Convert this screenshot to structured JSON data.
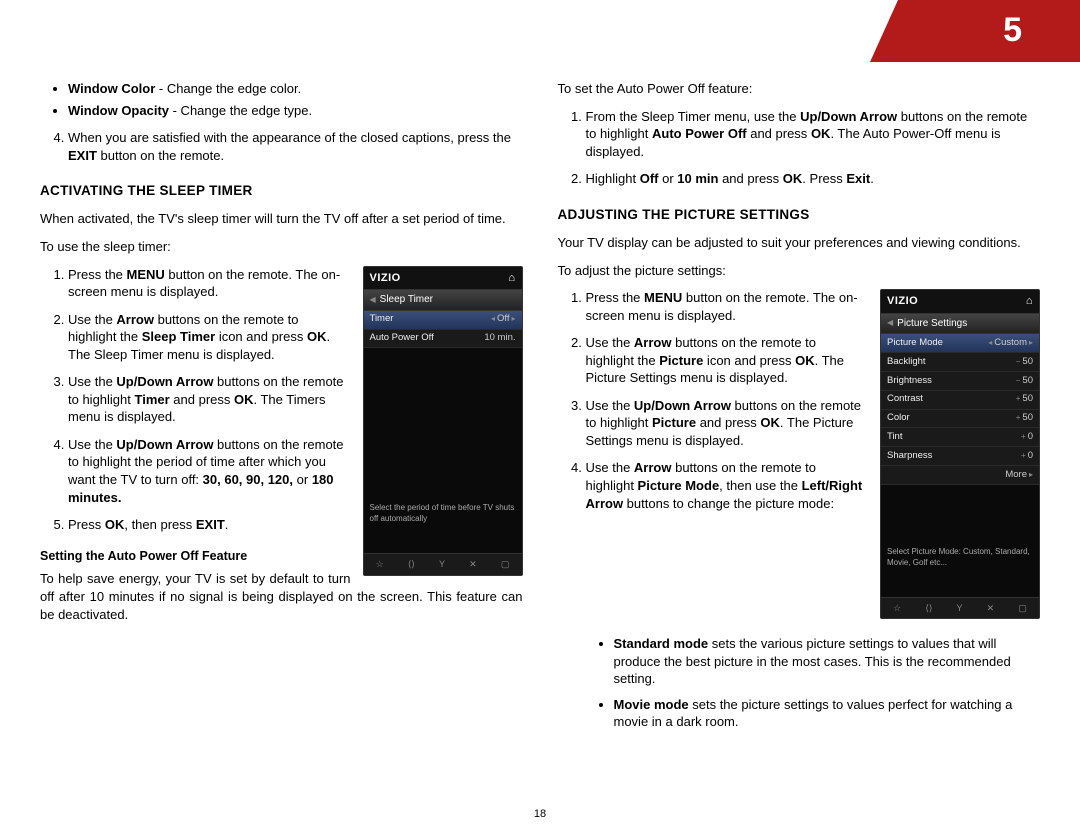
{
  "chapter": "5",
  "pageNumber": "18",
  "col1": {
    "bullets": [
      {
        "label": "Window Color",
        "desc": " - Change the edge color."
      },
      {
        "label": "Window Opacity",
        "desc": " - Change the edge type."
      }
    ],
    "step4_pre": "When you are satisfied with the appearance of the closed captions, press the ",
    "step4_bold": "EXIT",
    "step4_post": " button on the remote.",
    "h_sleeptimer": "Activating the Sleep Timer",
    "sleep_intro": "When activated, the TV's sleep timer will turn the TV off after a set period of time.",
    "sleep_lead": "To use the sleep timer:",
    "sleep_steps": {
      "s1a": "Press the ",
      "s1b": "MENU",
      "s1c": " button on the remote. The on-screen menu is displayed.",
      "s2a": "Use the ",
      "s2b": "Arrow",
      "s2c": " buttons on the remote to highlight the ",
      "s2d": "Sleep Timer",
      "s2e": " icon and press ",
      "s2f": "OK",
      "s2g": ". The Sleep Timer menu is displayed.",
      "s3a": "Use the ",
      "s3b": "Up/Down Arrow",
      "s3c": " buttons on the remote to highlight ",
      "s3d": "Timer",
      "s3e": " and press ",
      "s3f": "OK",
      "s3g": ". The Timers menu is displayed.",
      "s4a": "Use the ",
      "s4b": "Up/Down Arrow",
      "s4c": " buttons on the remote to highlight the period of time after which you want the TV to turn off: ",
      "s4d": "30, 60, 90, 120,",
      "s4e": " or ",
      "s4f": "180 minutes.",
      "s5a": "Press ",
      "s5b": "OK",
      "s5c": ", then press ",
      "s5d": "EXIT",
      "s5e": "."
    },
    "h_autopower": "Setting the Auto Power Off Feature",
    "autopower_para": "To help save energy, your TV is set by default to turn off after 10 minutes if no signal is being displayed on the screen. This feature can be deactivated."
  },
  "col2": {
    "ap_lead": "To set the Auto Power Off feature:",
    "ap_steps": {
      "s1a": "From the Sleep Timer menu, use the ",
      "s1b": "Up/Down Arrow",
      "s1c": " buttons on the remote to highlight ",
      "s1d": "Auto Power Off",
      "s1e": " and press ",
      "s1f": "OK",
      "s1g": ". The Auto Power-Off menu is displayed.",
      "s2a": "Highlight ",
      "s2b": "Off",
      "s2c": " or ",
      "s2d": "10 min",
      "s2e": " and press ",
      "s2f": "OK",
      "s2g": ". Press ",
      "s2h": "Exit",
      "s2i": "."
    },
    "h_picture": "Adjusting the Picture Settings",
    "pic_intro": "Your TV display can be adjusted to suit your preferences and viewing conditions.",
    "pic_lead": "To adjust the picture settings:",
    "pic_steps": {
      "s1a": "Press the ",
      "s1b": "MENU",
      "s1c": " button on the remote. The on-screen menu is displayed.",
      "s2a": "Use the ",
      "s2b": "Arrow",
      "s2c": " buttons on the remote to highlight the ",
      "s2d": "Picture",
      "s2e": " icon and press ",
      "s2f": "OK",
      "s2g": ". The Picture Settings menu is displayed.",
      "s3a": "Use the ",
      "s3b": "Up/Down Arrow",
      "s3c": " buttons on the remote to highlight ",
      "s3d": "Picture",
      "s3e": " and press ",
      "s3f": "OK",
      "s3g": ". The Picture Settings menu is displayed.",
      "s4a": "Use the ",
      "s4b": "Arrow",
      "s4c": " buttons on the remote to highlight ",
      "s4d": "Picture Mode",
      "s4e": ", then use the ",
      "s4f": "Left/Right Arrow",
      "s4g": " buttons to change the picture mode:"
    },
    "modes": {
      "m1a": "Standard mode",
      "m1b": " sets the various picture settings to values that will produce the best picture in the most cases. This is the recommended setting.",
      "m2a": "Movie mode",
      "m2b": " sets the picture settings to values perfect for watching a movie in a dark room."
    }
  },
  "screen1": {
    "brand": "VIZIO",
    "title": "Sleep Timer",
    "rows": [
      {
        "label": "Timer",
        "val": "Off"
      },
      {
        "label": "Auto Power Off",
        "val": "10 min."
      }
    ],
    "hint": "Select the period of time before TV shuts off automatically"
  },
  "screen2": {
    "brand": "VIZIO",
    "title": "Picture Settings",
    "rows": [
      {
        "label": "Picture Mode",
        "val": "Custom",
        "sel": true,
        "arrows": true
      },
      {
        "label": "Backlight",
        "val": "50",
        "slider": true
      },
      {
        "label": "Brightness",
        "val": "50",
        "slider": true
      },
      {
        "label": "Contrast",
        "val": "50",
        "slider": true
      },
      {
        "label": "Color",
        "val": "50",
        "slider": true
      },
      {
        "label": "Tint",
        "val": "0",
        "slider": true
      },
      {
        "label": "Sharpness",
        "val": "0",
        "slider": true
      },
      {
        "label": "",
        "val": "More",
        "arrows_r": true
      }
    ],
    "hint": "Select Picture Mode: Custom, Standard, Movie, Golf etc..."
  }
}
